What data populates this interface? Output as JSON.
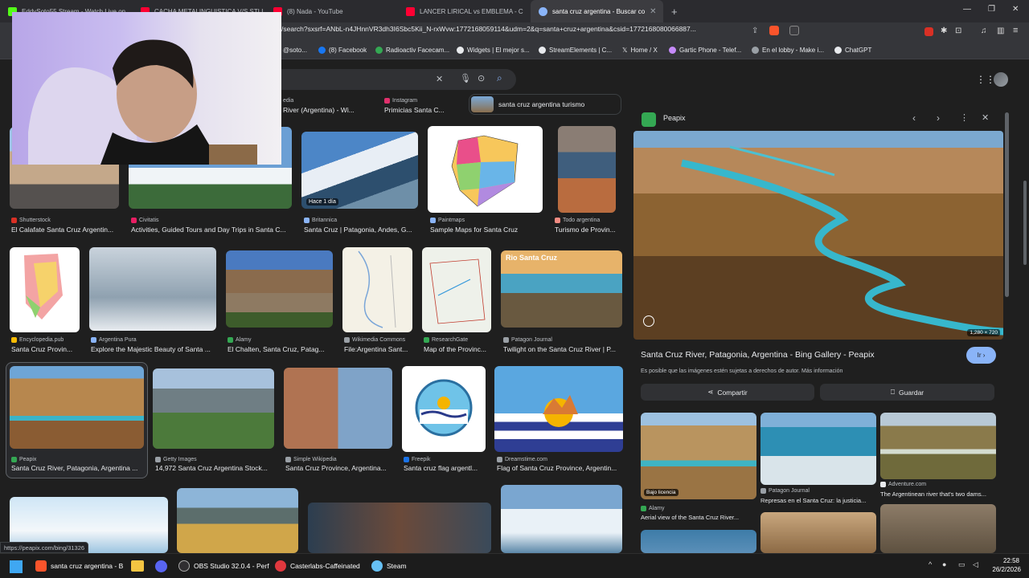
{
  "tabs": [
    {
      "label": "EddySoto55 Stream - Watch Live on",
      "favicon_color": "#53fc18"
    },
    {
      "label": "CACHA METALINGUISTICA V/S STLLA",
      "favicon_color": "#ff0033"
    },
    {
      "label": "(8) Nada - YouTube",
      "favicon_color": "#ff0033"
    },
    {
      "label": "LANCER LIRICAL vs EMBLEMA - C",
      "favicon_color": "#ff0033"
    },
    {
      "label": "santa cruz argentina - Buscar co",
      "favicon_color": "#8ab4f8",
      "active": true
    }
  ],
  "new_tab_label": "+",
  "address": {
    "url": "/search?sxsrf=ANbL-n4JHnnVR3dh3I6Sbc5Kii_N-rxWvw:1772168059114&udm=2&q=santa+cruz+argentina&csid=1772168080066887..."
  },
  "bookmarks": [
    {
      "label": "@soto...",
      "color": "#9aa0a6"
    },
    {
      "label": "(8) Facebook",
      "color": "#1877f2"
    },
    {
      "label": "Radioactiv Facecam...",
      "color": "#34a853"
    },
    {
      "label": "Widgets | El mejor s...",
      "color": "#e8eaed"
    },
    {
      "label": "StreamElements | C...",
      "color": "#e8eaed"
    },
    {
      "label": "Home / X",
      "color": "#e8eaed"
    },
    {
      "label": "Gartic Phone - Telef...",
      "color": "#c58af9"
    },
    {
      "label": "En el lobby - Make i...",
      "color": "#9aa0a6"
    },
    {
      "label": "ChatGPT",
      "color": "#e8eaed"
    }
  ],
  "chips": [
    {
      "source": "Instagram",
      "text": "Primicias Santa C..."
    },
    {
      "text": "santa cruz argentina turismo"
    }
  ],
  "top_row_titles": [
    {
      "source": "",
      "title": "River (Argentina) - Wi..."
    }
  ],
  "results": [
    {
      "source": "Shutterstock",
      "title": "El Calafate Santa Cruz Argentin...",
      "color": "#d93025"
    },
    {
      "source": "Civitatis",
      "title": "Activities, Guided Tours and Day Trips in Santa C...",
      "color": "#e91e63"
    },
    {
      "source": "Britannica",
      "title": "Santa Cruz | Patagonia, Andes, G...",
      "color": "#8ab4f8",
      "badge": "Hace 1 día"
    },
    {
      "source": "Paintmaps",
      "title": "Sample Maps for Santa Cruz",
      "color": "#8ab4f8"
    },
    {
      "source": "Todo argentina",
      "title": "Turismo de Provin...",
      "color": "#f28b82"
    },
    {
      "source": "Encyclopedia.pub",
      "title": "Santa Cruz Provin...",
      "color": "#fbbc04"
    },
    {
      "source": "Argentina Pura",
      "title": "Explore the Majestic Beauty of Santa ...",
      "color": "#8ab4f8"
    },
    {
      "source": "Alamy",
      "title": "El Chalten, Santa Cruz, Patag...",
      "color": "#34a853"
    },
    {
      "source": "Wikimedia Commons",
      "title": "File:Argentina Sant...",
      "color": "#9aa0a6"
    },
    {
      "source": "ResearchGate",
      "title": "Map of the Provinc...",
      "color": "#34a853"
    },
    {
      "source": "Patagon Journal",
      "title": "Twilight on the Santa Cruz River | P...",
      "color": "#9aa0a6",
      "overlay": "Rio Santa Cruz"
    },
    {
      "source": "Peapix",
      "title": "Santa Cruz River, Patagonia, Argentina ...",
      "color": "#34a853"
    },
    {
      "source": "Getty Images",
      "title": "14,972 Santa Cruz Argentina Stock...",
      "color": "#9aa0a6"
    },
    {
      "source": "Simple Wikipedia",
      "title": "Santa Cruz Province, Argentina...",
      "color": "#9aa0a6"
    },
    {
      "source": "Freepik",
      "title": "Santa cruz flag argentl...",
      "color": "#1a73e8"
    },
    {
      "source": "Dreamstime.com",
      "title": "Flag of Santa Cruz Province, Argentin...",
      "color": "#9aa0a6"
    }
  ],
  "panel": {
    "source": "Peapix",
    "image_size": "1,280 × 720",
    "title": "Santa Cruz River, Patagonia, Argentina - Bing Gallery - Peapix",
    "visit_label": "Ir",
    "copyright": "Es posible que las imágenes estén sujetas a derechos de autor.",
    "more_info": "Más información",
    "share_label": "Compartir",
    "save_label": "Guardar",
    "related": [
      {
        "badge": "Bajo licencia",
        "source": "Alamy",
        "title": "Aerial view of the Santa Cruz River..."
      },
      {
        "source": "Patagon Journal",
        "title": "Represas en el Santa Cruz: la justicia..."
      },
      {
        "source": "Adventure.com",
        "title": "The Argentinean river that's two dams..."
      }
    ]
  },
  "status_url": "https://peapix.com/bing/31326",
  "taskbar": {
    "apps": [
      {
        "label": "santa cruz argentina - B",
        "color": "#fb542b"
      },
      {
        "label": "OBS Studio 32.0.4 - Perf",
        "color": "#302e31"
      },
      {
        "label": "Casterlabs-Caffeinated",
        "color": "#e0383e"
      },
      {
        "label": "Steam",
        "color": "#66c0f4"
      }
    ],
    "time": "22:58",
    "date": "26/2/2026"
  }
}
